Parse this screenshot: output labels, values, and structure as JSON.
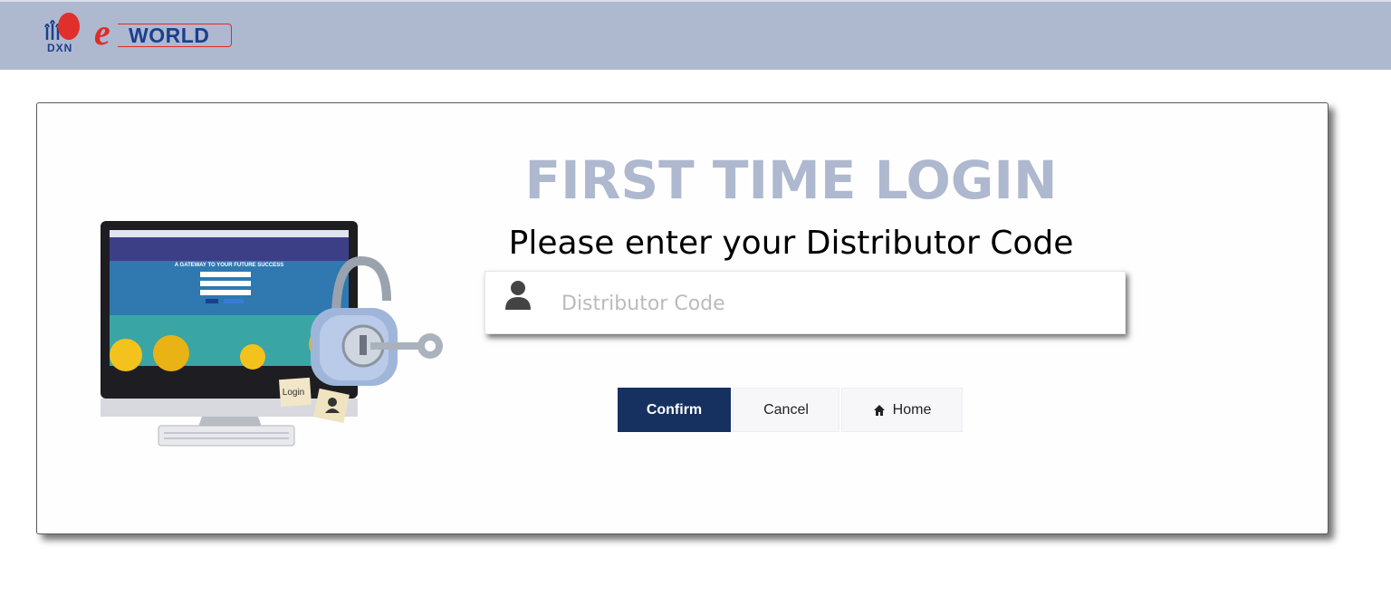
{
  "header": {
    "logo_dxn": "DXN",
    "logo_eworld_e": "e",
    "logo_eworld_word": "WORLD"
  },
  "illustration": {
    "screen_headline": "A GATEWAY TO YOUR FUTURE SUCCESS",
    "note_label": "Login"
  },
  "main": {
    "title": "FIRST TIME LOGIN",
    "subtitle": "Please enter your Distributor Code",
    "distributor_code": {
      "value": "",
      "placeholder": "Distributor Code"
    }
  },
  "buttons": {
    "confirm": "Confirm",
    "cancel": "Cancel",
    "home": "Home"
  },
  "colors": {
    "header_bg": "#aeb8cf",
    "title_color": "#aeb8cf",
    "confirm_bg": "#16315f",
    "brand_red": "#e02a28",
    "brand_blue": "#1b3f8f"
  },
  "icons": [
    "user-icon",
    "home-icon",
    "padlock-icon",
    "key-icon",
    "monitor-icon",
    "keyboard-icon"
  ]
}
